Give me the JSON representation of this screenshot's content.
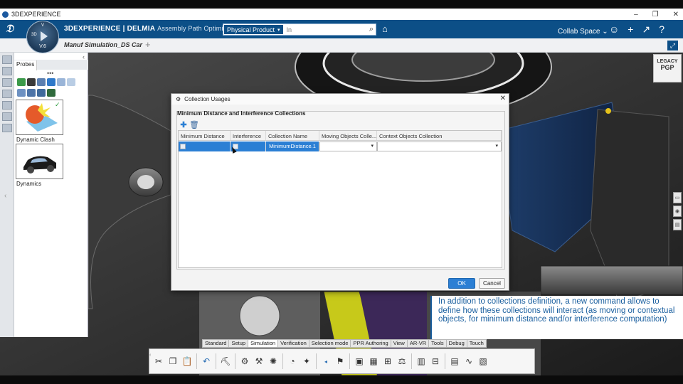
{
  "window": {
    "title": "3DEXPERIENCE",
    "controls": [
      "–",
      "❐",
      "✕"
    ]
  },
  "compass": {
    "version": "V.6",
    "d3": "3D",
    "v": "V"
  },
  "brand": {
    "name": "3DEXPERIENCE | DELMIA",
    "app": "Assembly Path Optimizat..."
  },
  "search": {
    "context": "Physical Product",
    "placeholder": "In"
  },
  "collab": {
    "label": "Collab Space ⌄"
  },
  "tab": {
    "label": "Manuf Simulation_DS Car"
  },
  "panel": {
    "tab_label": "Probes",
    "cards": [
      {
        "label": "Dynamic Clash"
      },
      {
        "label": "Dynamics"
      }
    ]
  },
  "legacy": {
    "line1": "LEGACY",
    "line2": "PGP"
  },
  "dialog": {
    "title": "Collection Usages",
    "group_label": "Minimum Distance and Interference Collections",
    "columns": [
      "Minimum Distance",
      "Interference",
      "Collection Name",
      "Moving Objects Colle...",
      "Context Objects Collection"
    ],
    "rows": [
      {
        "name": "MinimumDistance.1"
      }
    ],
    "ok": "OK",
    "cancel": "Cancel"
  },
  "caption": {
    "text": "In addition to collections definition, a new command allows to define how these collections will interact (as moving or contextual objects, for minimum distance and/or interference computation)"
  },
  "toolbar_tabs": [
    "Standard",
    "Setup",
    "Simulation",
    "Verification",
    "Selection mode",
    "PPR Authoring",
    "View",
    "AR-VR",
    "Tools",
    "Debug",
    "Touch"
  ],
  "active_tab": "Simulation",
  "colors": {
    "accent": "#0c4f87",
    "selection": "#2b7fd4",
    "caption_text": "#1a5f9f"
  }
}
